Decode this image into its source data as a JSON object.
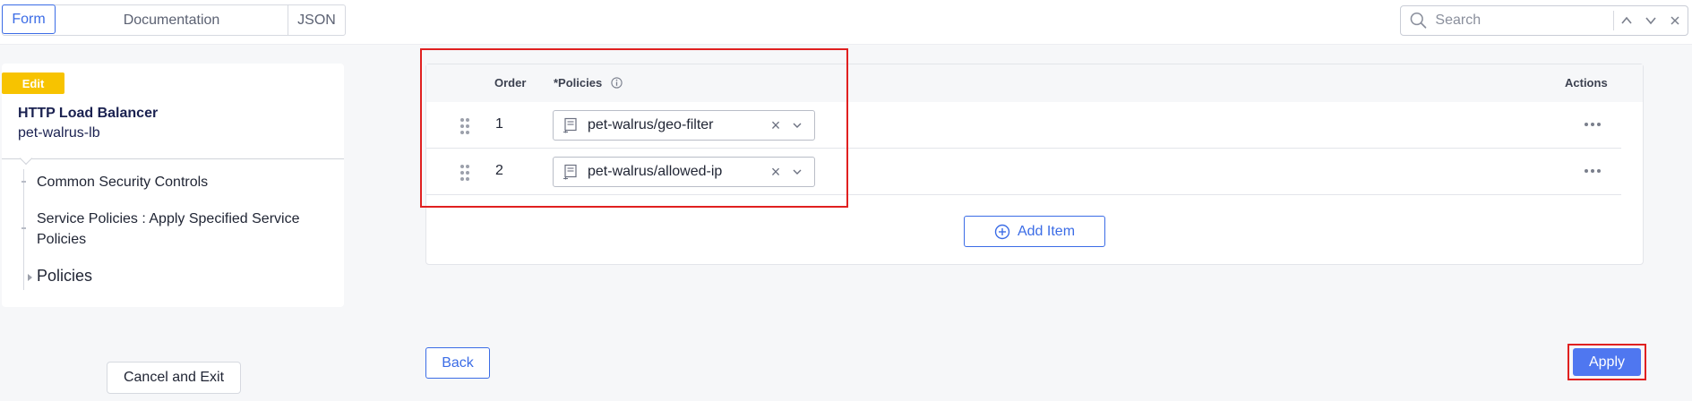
{
  "view_tabs": {
    "form": "Form",
    "documentation": "Documentation",
    "json": "JSON"
  },
  "search": {
    "placeholder": "Search",
    "value": ""
  },
  "left_panel": {
    "badge": "Edit",
    "object_type": "HTTP Load Balancer",
    "object_name": "pet-walrus-lb",
    "nav_items": [
      {
        "label": "Common Security Controls"
      },
      {
        "label": "Service Policies : Apply Specified Service Policies"
      },
      {
        "label": "Policies"
      }
    ],
    "cancel_label": "Cancel and Exit"
  },
  "table": {
    "headers": {
      "order": "Order",
      "policies": "*Policies",
      "actions": "Actions"
    },
    "rows": [
      {
        "order": "1",
        "policy": "pet-walrus/geo-filter"
      },
      {
        "order": "2",
        "policy": "pet-walrus/allowed-ip"
      }
    ],
    "add_item_label": "Add Item"
  },
  "footer": {
    "back_label": "Back",
    "apply_label": "Apply"
  },
  "colors": {
    "accent": "#3b6ce6",
    "apply_bg": "#4f77f0",
    "badge": "#f7c300",
    "highlight": "#e02020"
  }
}
